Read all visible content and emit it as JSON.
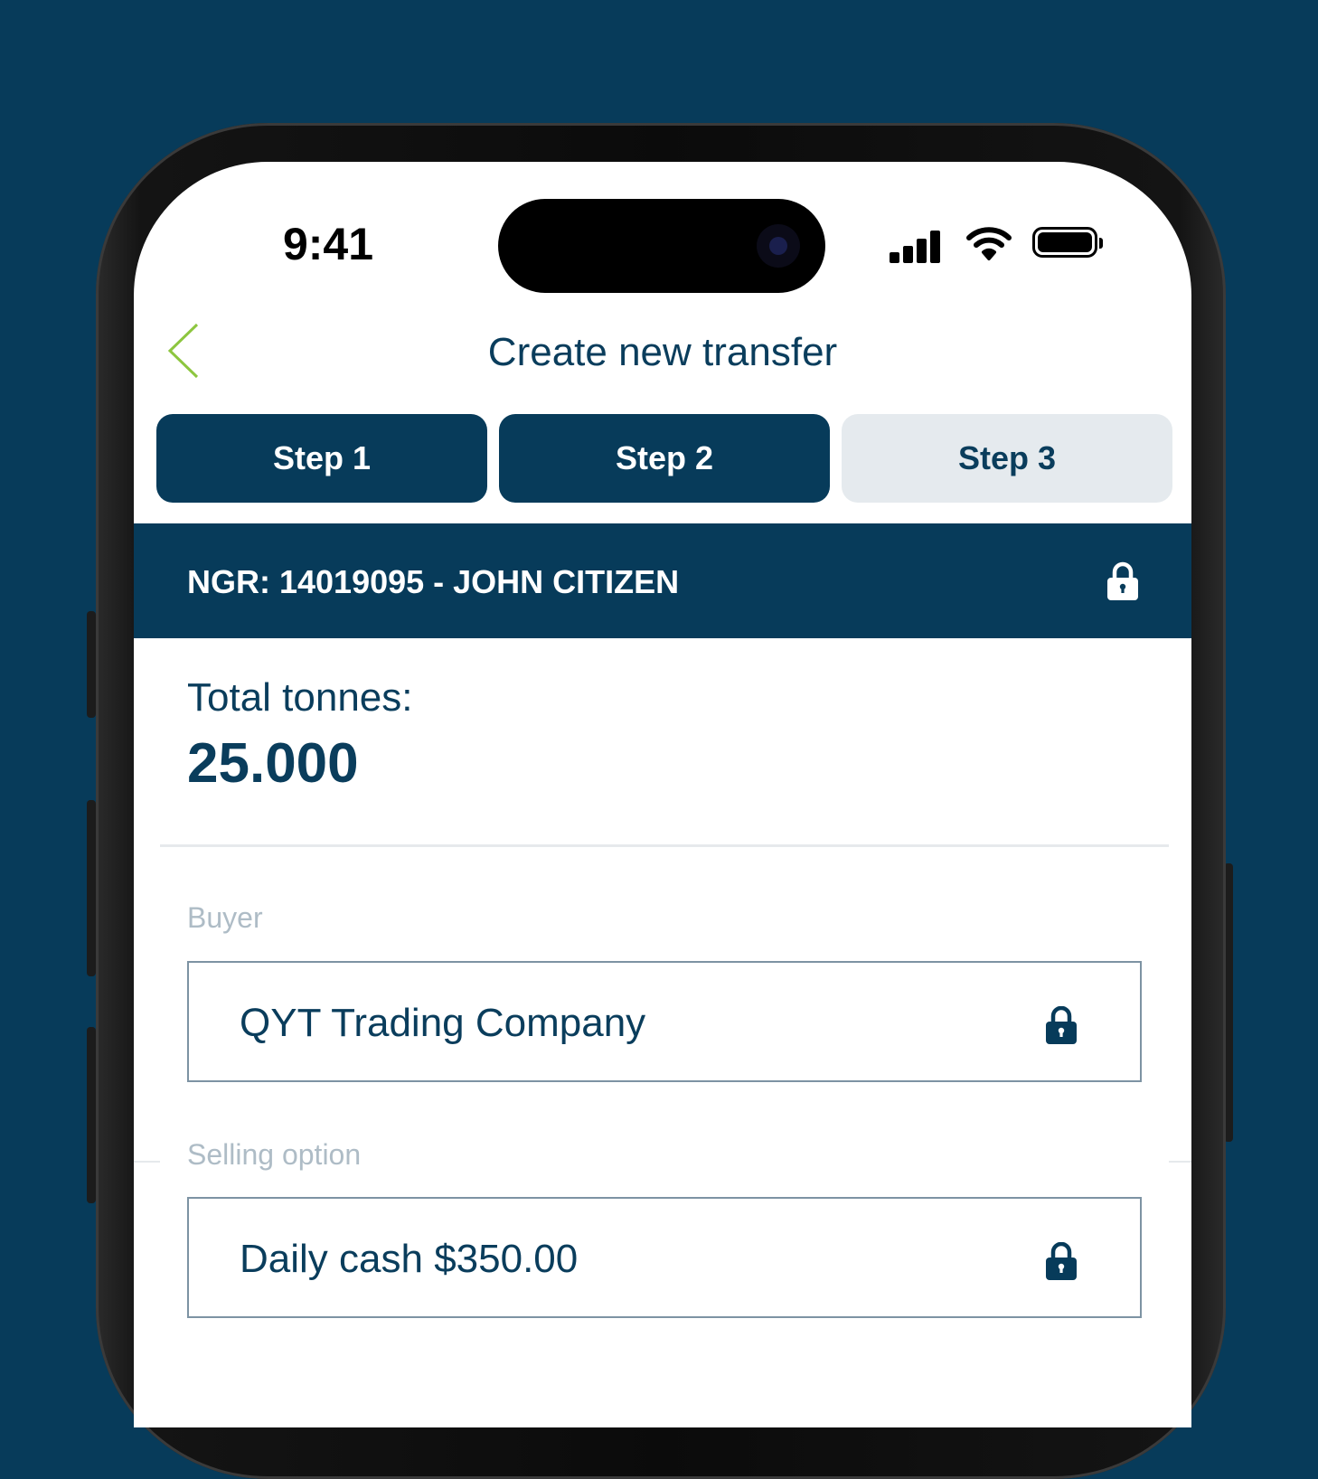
{
  "status_bar": {
    "time": "9:41"
  },
  "header": {
    "title": "Create new transfer"
  },
  "steps": [
    {
      "label": "Step 1",
      "state": "complete"
    },
    {
      "label": "Step 2",
      "state": "complete"
    },
    {
      "label": "Step 3",
      "state": "current"
    }
  ],
  "ngr": {
    "text": "NGR: 14019095 - JOHN CITIZEN"
  },
  "summary": {
    "label": "Total tonnes:",
    "value": "25.000"
  },
  "fields": {
    "buyer": {
      "label": "Buyer",
      "value": "QYT Trading Company"
    },
    "selling_option": {
      "label": "Selling option",
      "value": "Daily cash $350.00"
    }
  },
  "colors": {
    "background": "#073b5a",
    "primary": "#073b5a",
    "text_primary": "#0a3d5c",
    "step_inactive_bg": "#e5eaee",
    "back_accent": "#8dc63f",
    "label_muted": "#aebcc6",
    "field_border": "#7d93a3"
  },
  "icons": {
    "back": "chevron-left-icon",
    "lock": "lock-icon",
    "signal": "cellular-signal-icon",
    "wifi": "wifi-icon",
    "battery": "battery-icon"
  }
}
